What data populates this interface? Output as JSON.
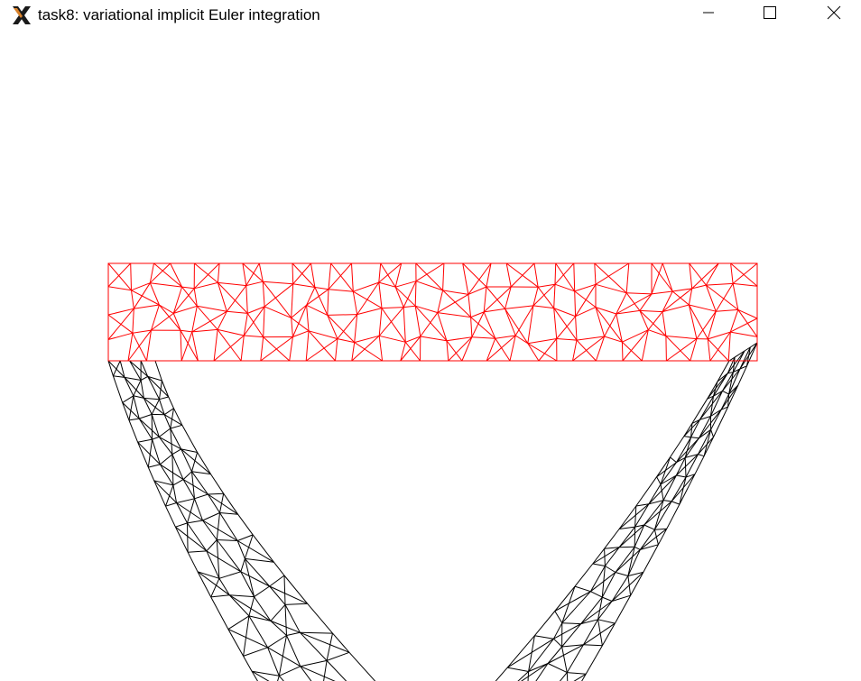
{
  "window": {
    "title": "task8: variational implicit Euler integration",
    "icon": "x11-app-icon",
    "controls": {
      "minimize_icon": "minimize-icon",
      "maximize_icon": "maximize-icon",
      "close_icon": "close-icon"
    }
  },
  "scene": {
    "rest_mesh_color": "#ff0000",
    "deformed_mesh_color": "#000000",
    "background_color": "#ffffff"
  }
}
